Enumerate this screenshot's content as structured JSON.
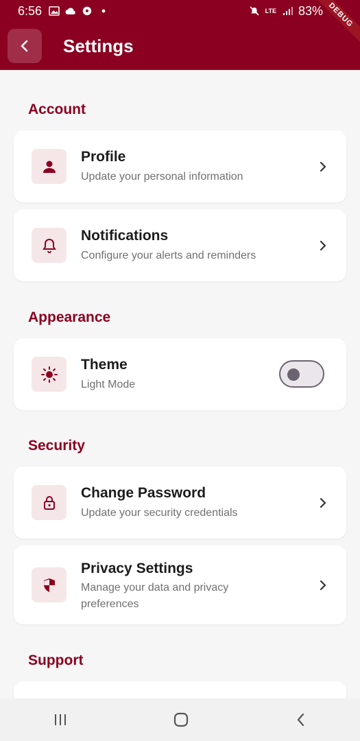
{
  "status_bar": {
    "time": "6:56",
    "network": "LTE",
    "battery": "83%",
    "left_icons": [
      "gallery-icon",
      "cloud-icon",
      "soccer-icon",
      "dot-icon"
    ],
    "right_icons": [
      "mute-icon",
      "lte-icon",
      "signal-icon"
    ]
  },
  "app_bar": {
    "title": "Settings",
    "back_icon": "chevron-left-icon",
    "debug_label": "DEBUG",
    "color": "#8b0020"
  },
  "sections": {
    "account": "Account",
    "appearance": "Appearance",
    "security": "Security",
    "support": "Support"
  },
  "items": {
    "profile": {
      "title": "Profile",
      "subtitle": "Update your personal information",
      "icon": "person-icon"
    },
    "notifications": {
      "title": "Notifications",
      "subtitle": "Configure your alerts and reminders",
      "icon": "bell-icon"
    },
    "theme": {
      "title": "Theme",
      "subtitle": "Light Mode",
      "icon": "sun-icon",
      "toggle_on": false
    },
    "change_password": {
      "title": "Change Password",
      "subtitle": "Update your security credentials",
      "icon": "lock-icon"
    },
    "privacy": {
      "title": "Privacy Settings",
      "subtitle": "Manage your data and privacy preferences",
      "icon": "shield-icon"
    }
  },
  "nav_bar": {
    "icons": [
      "recents-icon",
      "home-icon",
      "back-icon"
    ]
  }
}
